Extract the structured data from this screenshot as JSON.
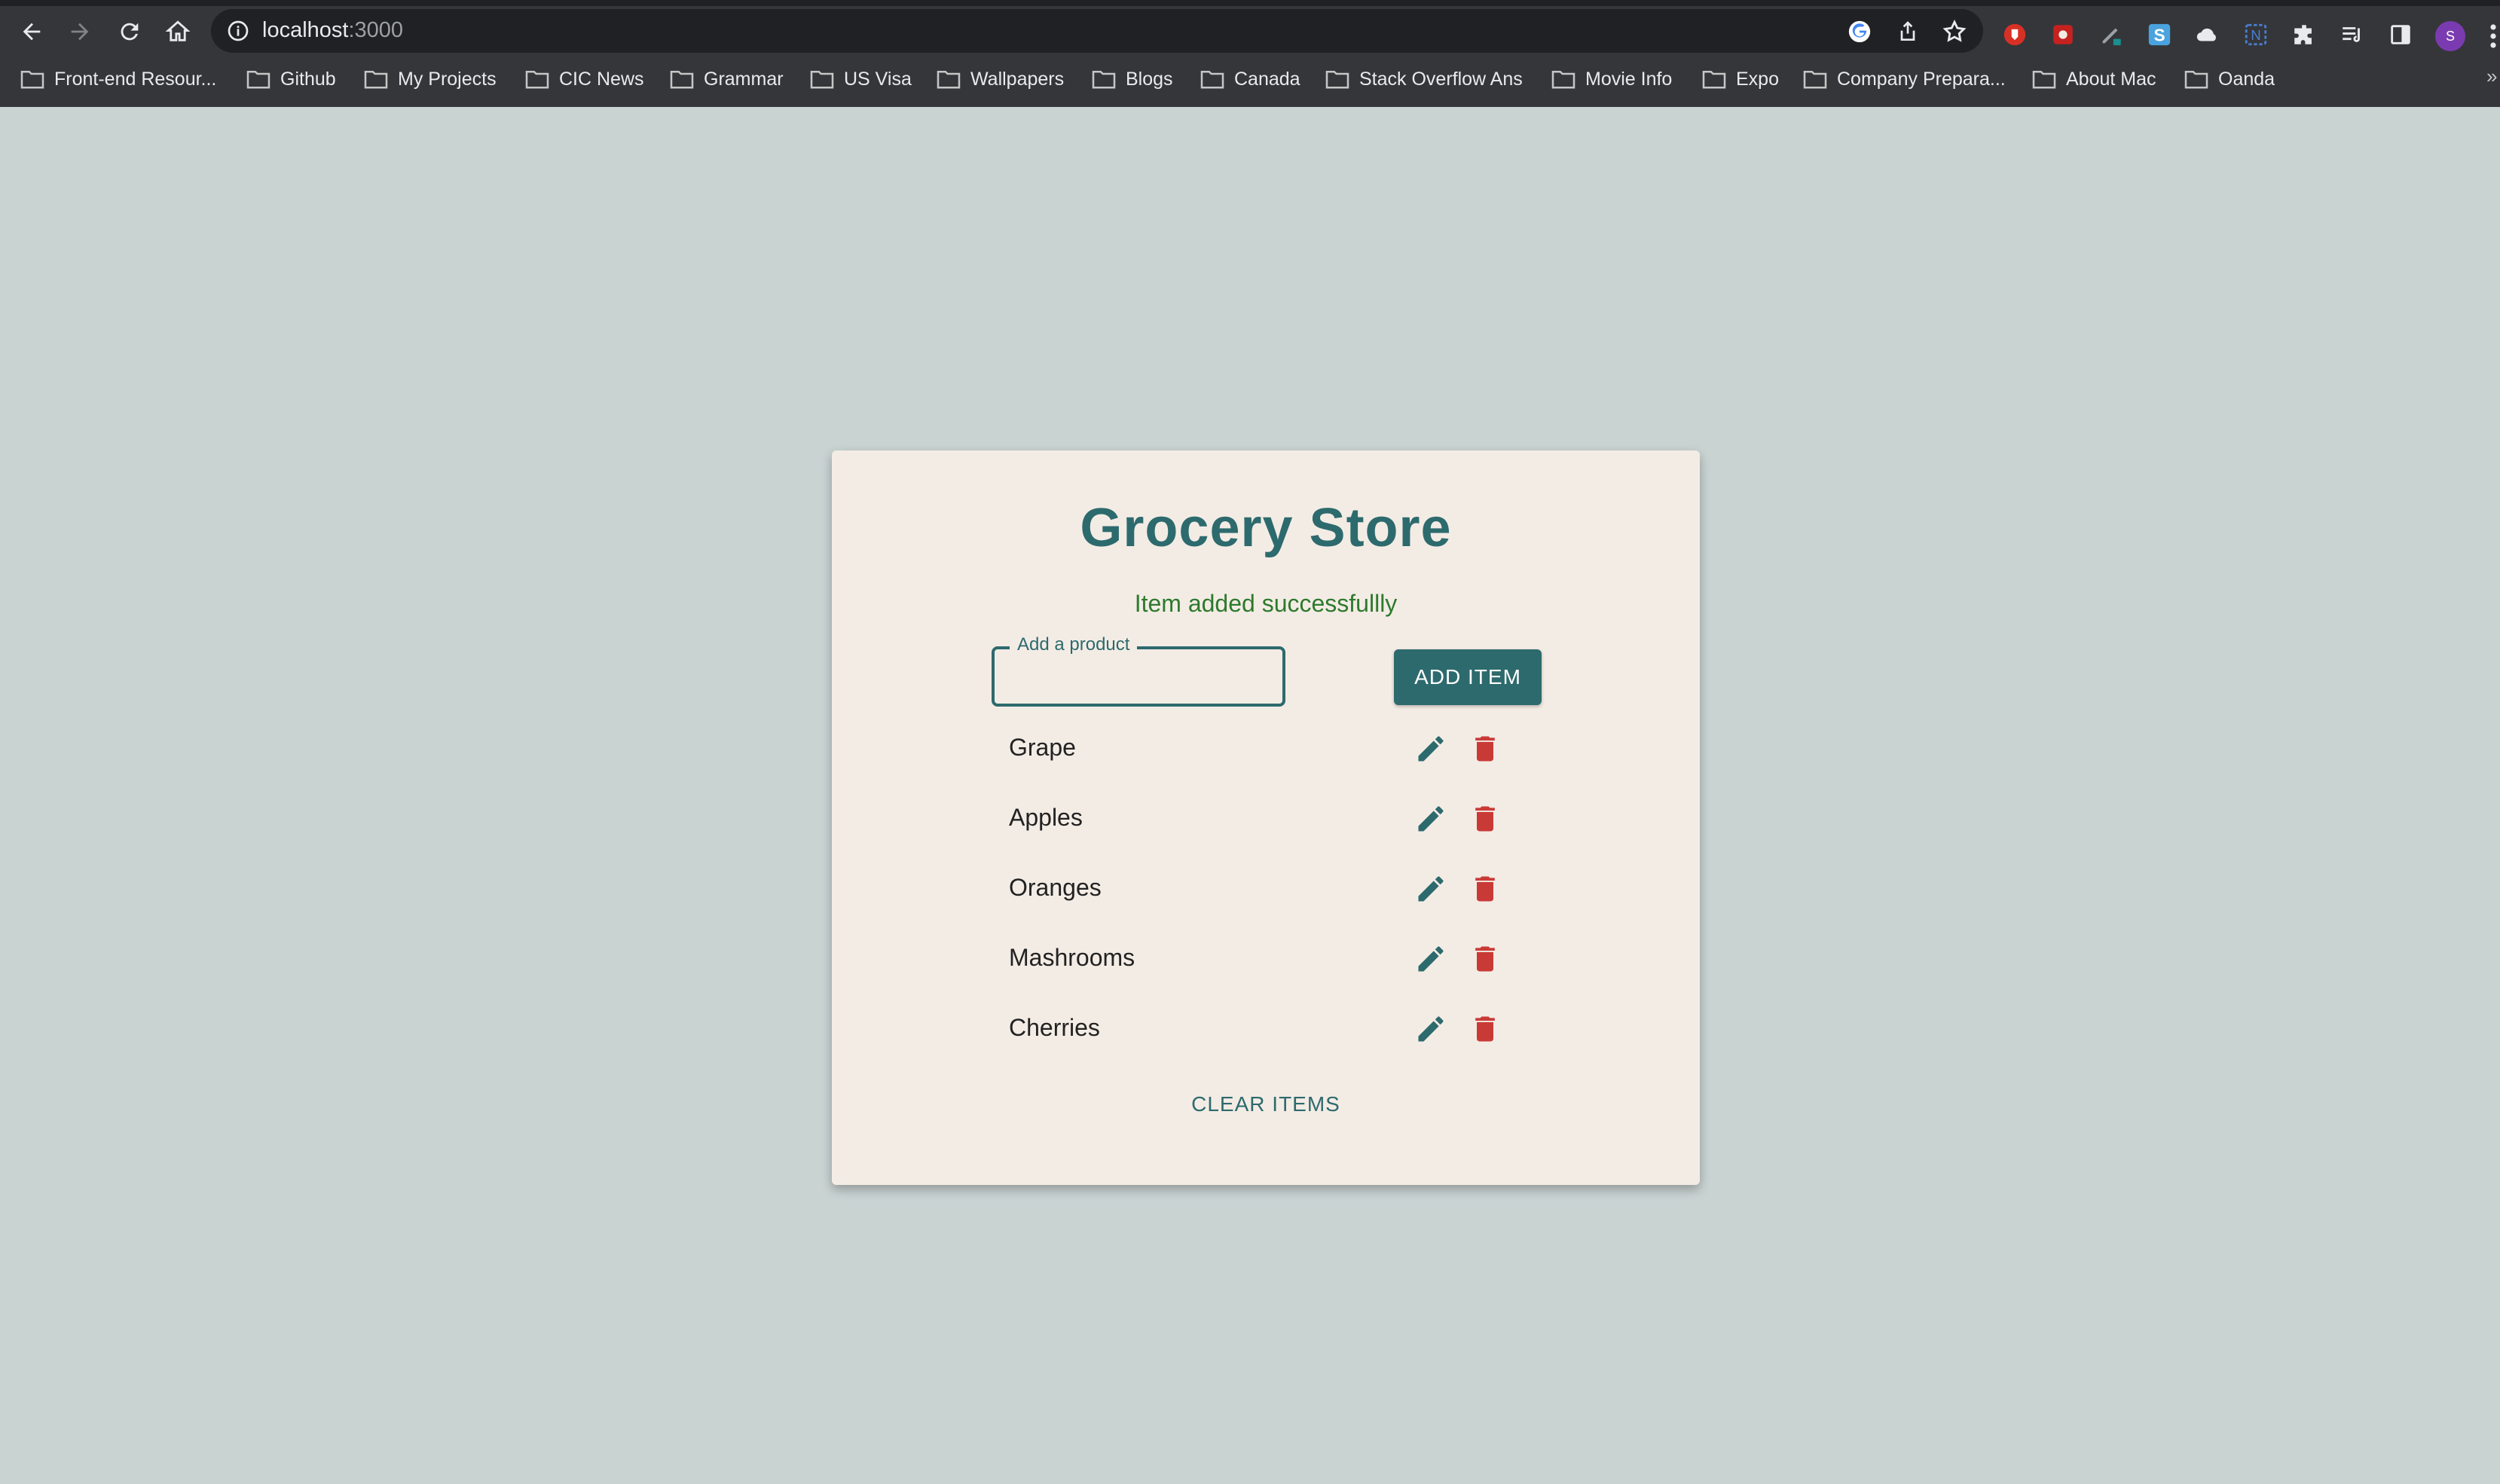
{
  "browser": {
    "url_host": "localhost",
    "url_port": ":3000",
    "profile_initial": "S",
    "bookmarks_overflow": "»",
    "bookmarks": [
      "Front-end Resour...",
      "Github",
      "My Projects",
      "CIC News",
      "Grammar",
      "US Visa",
      "Wallpapers",
      "Blogs",
      "Canada",
      "Stack Overflow Ans",
      "Movie Info",
      "Expo",
      "Company Prepara...",
      "About Mac",
      "Oanda"
    ]
  },
  "app": {
    "title": "Grocery Store",
    "alert": "Item added successfullly",
    "alert_color": "#2d7a2d",
    "accent_color": "#2d6a6d",
    "danger_color": "#c93a37",
    "input": {
      "label": "Add a product",
      "value": ""
    },
    "add_button": "ADD ITEM",
    "items": [
      "Grape",
      "Apples",
      "Oranges",
      "Mashrooms",
      "Cherries"
    ],
    "clear_button": "CLEAR ITEMS",
    "item_icons": [
      "pencil-icon",
      "trash-icon"
    ]
  }
}
